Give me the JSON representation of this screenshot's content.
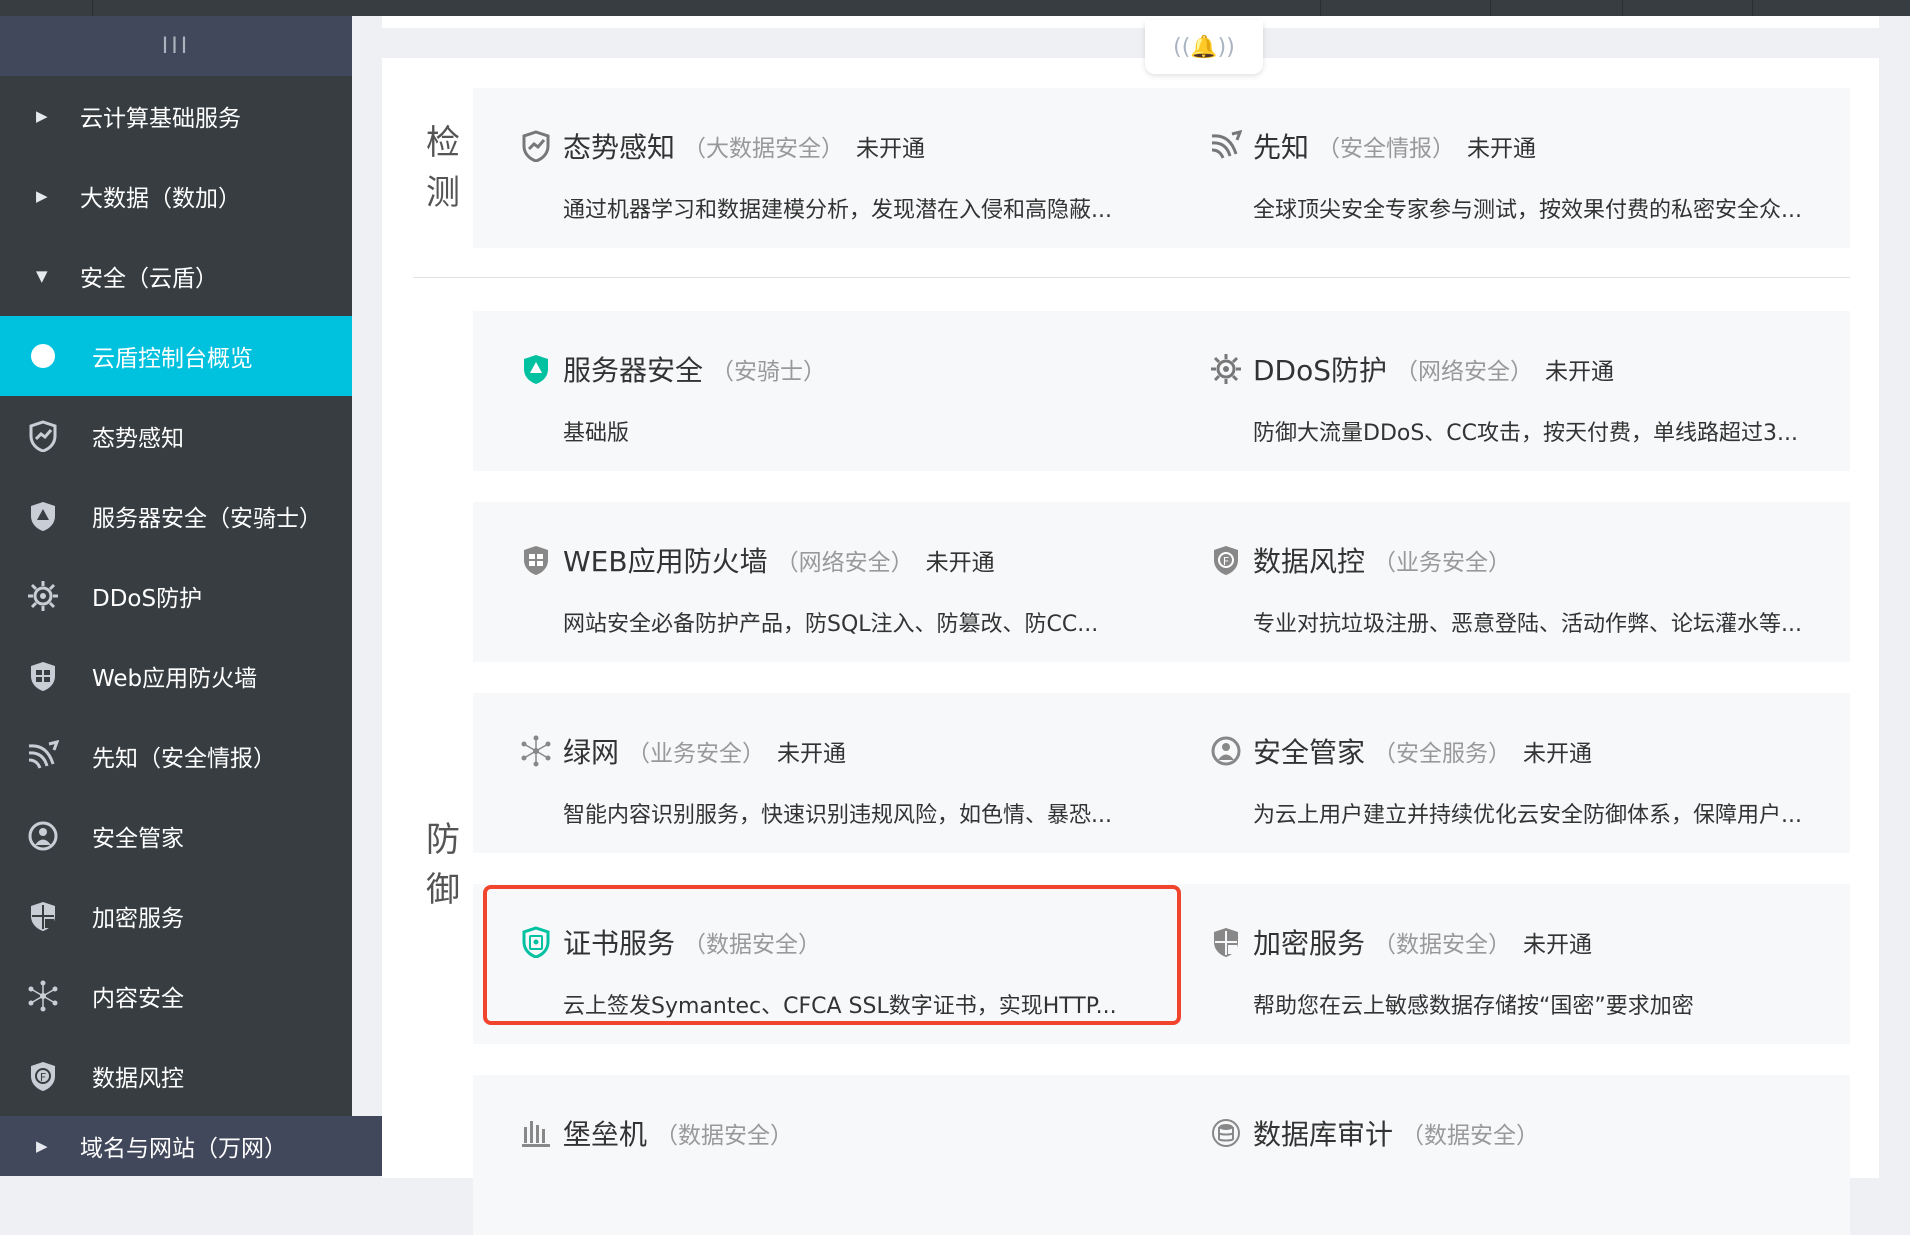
{
  "sidebar": {
    "toggle_label": "III",
    "groups": [
      {
        "label": "云计算基础服务",
        "caret": "▶"
      },
      {
        "label": "大数据（数加）",
        "caret": "▶"
      },
      {
        "label": "安全（云盾）",
        "caret": "▼"
      }
    ],
    "items": [
      {
        "label": "云盾控制台概览",
        "icon": "dot-icon",
        "active": true
      },
      {
        "label": "态势感知",
        "icon": "situation-awareness-icon"
      },
      {
        "label": "服务器安全（安骑士）",
        "icon": "server-security-icon"
      },
      {
        "label": "DDoS防护",
        "icon": "ddos-gear-icon"
      },
      {
        "label": "Web应用防火墙",
        "icon": "waf-shield-icon"
      },
      {
        "label": "先知（安全情报）",
        "icon": "intel-signal-icon"
      },
      {
        "label": "安全管家",
        "icon": "security-butler-icon"
      },
      {
        "label": "加密服务",
        "icon": "encryption-shield-icon"
      },
      {
        "label": "内容安全",
        "icon": "content-network-icon"
      },
      {
        "label": "数据风控",
        "icon": "data-risk-icon"
      }
    ],
    "bottom_group": {
      "label": "域名与网站（万网）",
      "caret": "▶"
    }
  },
  "bell_icon": "bell-icon",
  "sections": {
    "detect": "检测",
    "defend": "防御"
  },
  "cards": {
    "situation": {
      "name": "态势感知",
      "cat": "（大数据安全）",
      "status": "未开通",
      "desc": "通过机器学习和数据建模分析，发现潜在入侵和高隐蔽..."
    },
    "xianzhi": {
      "name": "先知",
      "cat": "（安全情报）",
      "status": "未开通",
      "desc": "全球顶尖安全专家参与测试，按效果付费的私密安全众..."
    },
    "server": {
      "name": "服务器安全",
      "cat": "（安骑士）",
      "status": "",
      "desc": "基础版"
    },
    "ddos": {
      "name": "DDoS防护",
      "cat": "（网络安全）",
      "status": "未开通",
      "desc": "防御大流量DDoS、CC攻击，按天付费，单线路超过3..."
    },
    "waf": {
      "name": "WEB应用防火墙",
      "cat": "（网络安全）",
      "status": "未开通",
      "desc": "网站安全必备防护产品，防SQL注入、防篡改、防CC..."
    },
    "risk": {
      "name": "数据风控",
      "cat": "（业务安全）",
      "status": "",
      "desc": "专业对抗垃圾注册、恶意登陆、活动作弊、论坛灌水等..."
    },
    "green": {
      "name": "绿网",
      "cat": "（业务安全）",
      "status": "未开通",
      "desc": "智能内容识别服务，快速识别违规风险，如色情、暴恐..."
    },
    "butler": {
      "name": "安全管家",
      "cat": "（安全服务）",
      "status": "未开通",
      "desc": "为云上用户建立并持续优化云安全防御体系，保障用户..."
    },
    "cert": {
      "name": "证书服务",
      "cat": "（数据安全）",
      "status": "",
      "desc": "云上签发Symantec、CFCA SSL数字证书，实现HTTP..."
    },
    "crypto": {
      "name": "加密服务",
      "cat": "（数据安全）",
      "status": "未开通",
      "desc": "帮助您在云上敏感数据存储按“国密”要求加密"
    },
    "bastion": {
      "name": "堡垒机",
      "cat": "（数据安全）",
      "status": "",
      "desc": ""
    },
    "dbaudit": {
      "name": "数据库审计",
      "cat": "（数据安全）",
      "status": "",
      "desc": ""
    }
  },
  "colors": {
    "accent": "#00c1de",
    "sidebar": "#373d41",
    "highlight": "#f0442c"
  }
}
